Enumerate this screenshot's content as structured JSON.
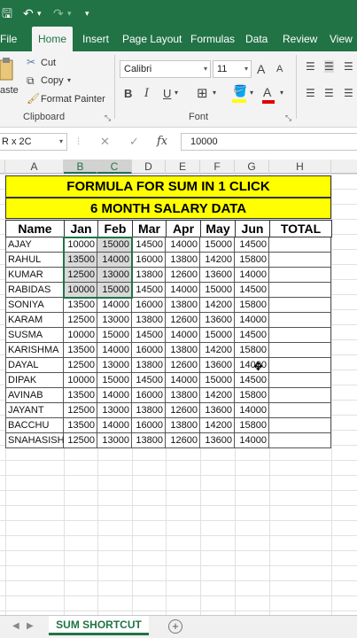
{
  "quick_access": {
    "save": "🖫",
    "undo": "↶",
    "undo_arrow": "▾",
    "redo": "↷",
    "redo_arrow": "▾",
    "customize": "▾"
  },
  "tabs": [
    "File",
    "Home",
    "Insert",
    "Page Layout",
    "Formulas",
    "Data",
    "Review",
    "View"
  ],
  "active_tab": "Home",
  "ribbon": {
    "paste_label": "aste",
    "cut_label": "Cut",
    "copy_label": "Copy",
    "format_painter_label": "Format Painter",
    "clipboard_group": "Clipboard",
    "font_name": "Calibri",
    "font_size": "11",
    "grow_font": "A",
    "shrink_font": "A",
    "bold": "B",
    "italic": "I",
    "underline": "U",
    "font_group": "Font",
    "font_color_letter": "A",
    "accent_color": "#217346"
  },
  "formula_bar": {
    "name_box": "R x 2C",
    "cancel": "✕",
    "enter": "✓",
    "fx": "fx",
    "value": "10000"
  },
  "columns": [
    "A",
    "B",
    "C",
    "D",
    "E",
    "F",
    "G",
    "H"
  ],
  "selected_columns": [
    "B",
    "C"
  ],
  "sheet": {
    "title1": "FORMULA FOR SUM IN 1 CLICK",
    "title2": "6 MONTH SALARY DATA",
    "headers": [
      "Name",
      "Jan",
      "Feb",
      "Mar",
      "Apr",
      "May",
      "Jun",
      "TOTAL"
    ],
    "rows": [
      [
        "AJAY",
        "10000",
        "15000",
        "14500",
        "14000",
        "15000",
        "14500",
        ""
      ],
      [
        "RAHUL",
        "13500",
        "14000",
        "16000",
        "13800",
        "14200",
        "15800",
        ""
      ],
      [
        "KUMAR",
        "12500",
        "13000",
        "13800",
        "12600",
        "13600",
        "14000",
        ""
      ],
      [
        "RABIDAS",
        "10000",
        "15000",
        "14500",
        "14000",
        "15000",
        "14500",
        ""
      ],
      [
        "SONIYA",
        "13500",
        "14000",
        "16000",
        "13800",
        "14200",
        "15800",
        ""
      ],
      [
        "KARAM",
        "12500",
        "13000",
        "13800",
        "12600",
        "13600",
        "14000",
        ""
      ],
      [
        "SUSMA",
        "10000",
        "15000",
        "14500",
        "14000",
        "15000",
        "14500",
        ""
      ],
      [
        "KARISHMA",
        "13500",
        "14000",
        "16000",
        "13800",
        "14200",
        "15800",
        ""
      ],
      [
        "DAYAL",
        "12500",
        "13000",
        "13800",
        "12600",
        "13600",
        "14000",
        ""
      ],
      [
        "DIPAK",
        "10000",
        "15000",
        "14500",
        "14000",
        "15000",
        "14500",
        ""
      ],
      [
        "AVINAB",
        "13500",
        "14000",
        "16000",
        "13800",
        "14200",
        "15800",
        ""
      ],
      [
        "JAYANT",
        "12500",
        "13000",
        "13800",
        "12600",
        "13600",
        "14000",
        ""
      ],
      [
        "BACCHU",
        "13500",
        "14000",
        "16000",
        "13800",
        "14200",
        "15800",
        ""
      ],
      [
        "SNAHASISH",
        "12500",
        "13000",
        "13800",
        "12600",
        "13600",
        "14000",
        ""
      ]
    ]
  },
  "sheet_tab": "SUM SHORTCUT",
  "add_sheet": "+"
}
